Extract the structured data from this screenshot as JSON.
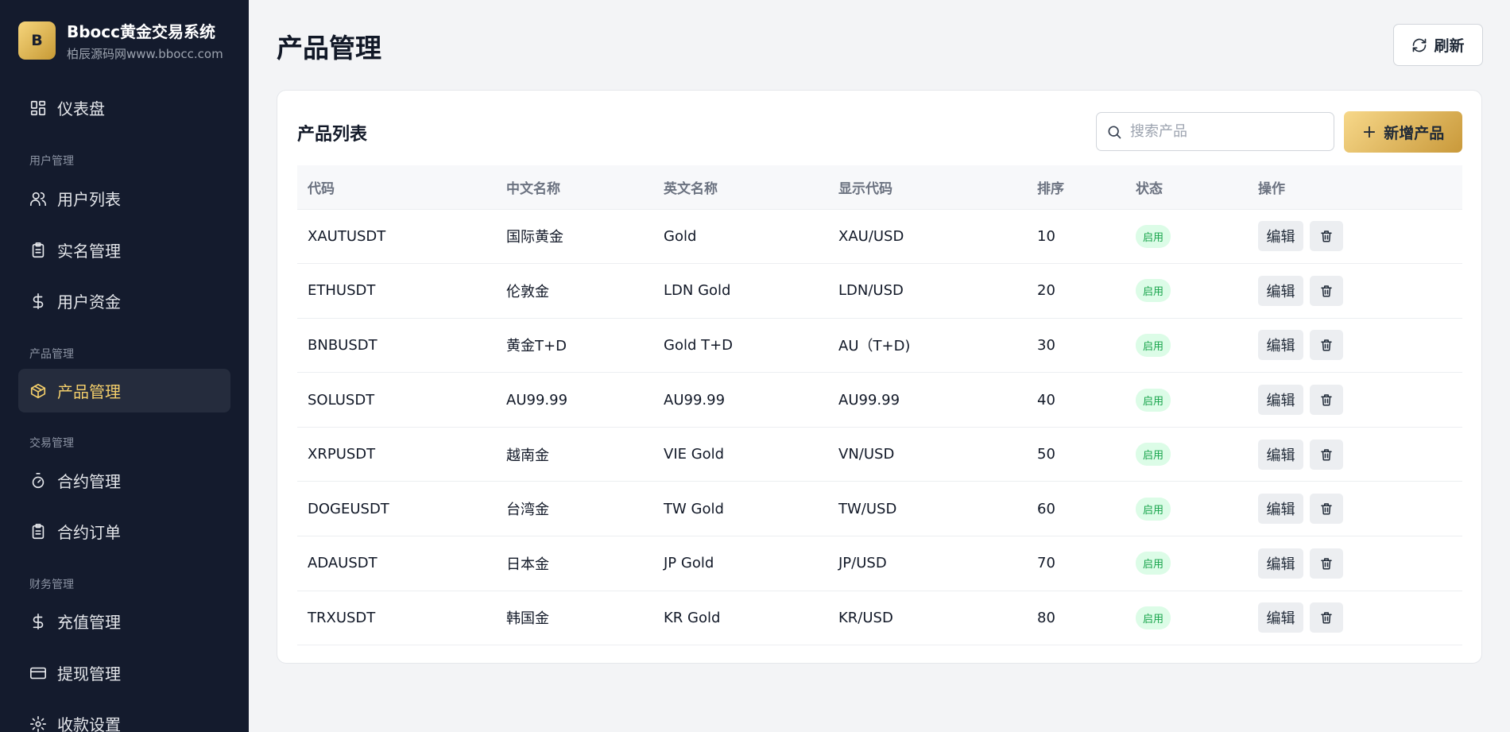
{
  "brand": {
    "logo_letter": "B",
    "title": "Bbocc黄金交易系统",
    "subtitle": "柏辰源码网www.bbocc.com"
  },
  "sidebar": {
    "dashboard": "仪表盘",
    "sections": {
      "user": "用户管理",
      "product": "产品管理",
      "trade": "交易管理",
      "finance": "财务管理"
    },
    "items": {
      "user_list": "用户列表",
      "realname": "实名管理",
      "user_funds": "用户资金",
      "product_mgmt": "产品管理",
      "contract_mgmt": "合约管理",
      "contract_orders": "合约订单",
      "recharge": "充值管理",
      "withdraw": "提现管理",
      "payment_settings": "收款设置"
    }
  },
  "header": {
    "title": "产品管理",
    "refresh_label": "刷新"
  },
  "card": {
    "title": "产品列表",
    "search_placeholder": "搜索产品",
    "add_label": "新增产品"
  },
  "table": {
    "headers": {
      "code": "代码",
      "name_cn": "中文名称",
      "name_en": "英文名称",
      "display_code": "显示代码",
      "sort": "排序",
      "status": "状态",
      "actions": "操作"
    },
    "edit_label": "编辑",
    "rows": [
      {
        "code": "XAUTUSDT",
        "name_cn": "国际黄金",
        "name_en": "Gold",
        "display_code": "XAU/USD",
        "sort": "10",
        "status": "启用"
      },
      {
        "code": "ETHUSDT",
        "name_cn": "伦敦金",
        "name_en": "LDN Gold",
        "display_code": "LDN/USD",
        "sort": "20",
        "status": "启用"
      },
      {
        "code": "BNBUSDT",
        "name_cn": "黄金T+D",
        "name_en": "Gold T+D",
        "display_code": "AU（T+D)",
        "sort": "30",
        "status": "启用"
      },
      {
        "code": "SOLUSDT",
        "name_cn": "AU99.99",
        "name_en": "AU99.99",
        "display_code": "AU99.99",
        "sort": "40",
        "status": "启用"
      },
      {
        "code": "XRPUSDT",
        "name_cn": "越南金",
        "name_en": "VIE Gold",
        "display_code": "VN/USD",
        "sort": "50",
        "status": "启用"
      },
      {
        "code": "DOGEUSDT",
        "name_cn": "台湾金",
        "name_en": "TW Gold",
        "display_code": "TW/USD",
        "sort": "60",
        "status": "启用"
      },
      {
        "code": "ADAUSDT",
        "name_cn": "日本金",
        "name_en": "JP Gold",
        "display_code": "JP/USD",
        "sort": "70",
        "status": "启用"
      },
      {
        "code": "TRXUSDT",
        "name_cn": "韩国金",
        "name_en": "KR Gold",
        "display_code": "KR/USD",
        "sort": "80",
        "status": "启用"
      }
    ]
  },
  "colors": {
    "sidebar_bg": "#141b2d",
    "accent_gold": "#f4cf6b",
    "status_green": "#16a34a",
    "status_green_bg": "#dcfce7"
  }
}
